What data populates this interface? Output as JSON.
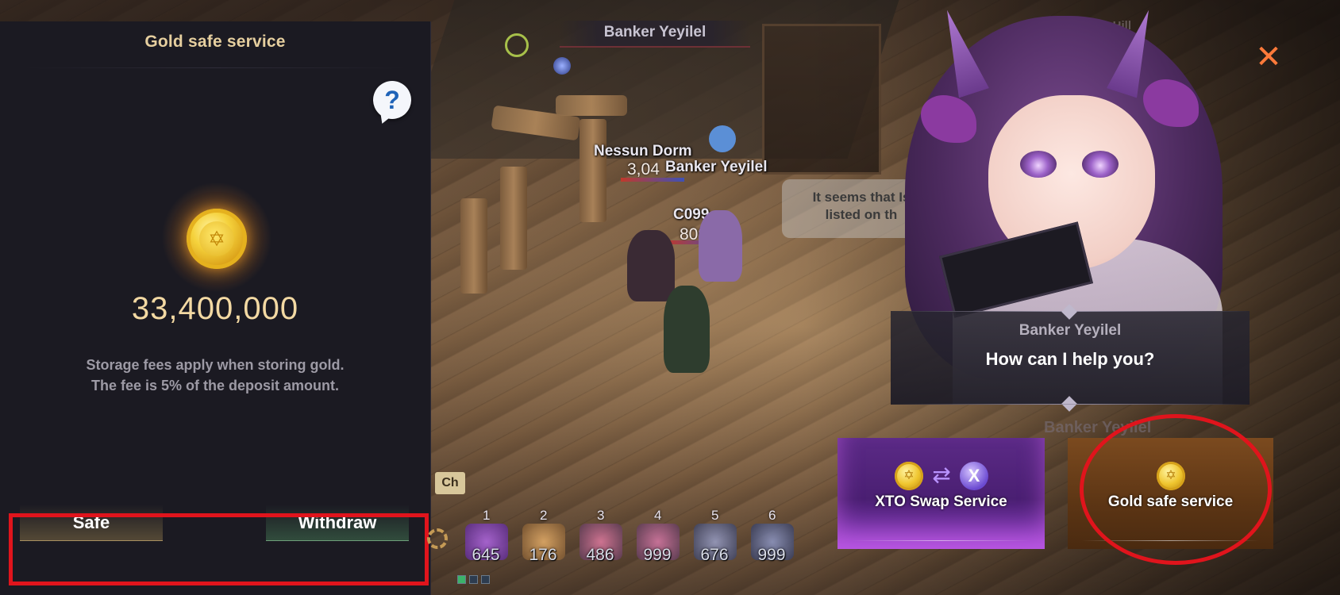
{
  "panel": {
    "title": "Gold safe service",
    "help_icon_glyph": "?",
    "gold_amount": "33,400,000",
    "fee_note_line1": "Storage fees apply when storing gold.",
    "fee_note_line2": "The fee is 5% of the deposit amount.",
    "safe_label": "Safe",
    "withdraw_label": "Withdraw"
  },
  "world": {
    "top_banner": "Banker Yeyilel",
    "players": [
      {
        "name": "Nessun Dorm",
        "value": "3,04"
      },
      {
        "name": "Banker Yeyilel"
      },
      {
        "name": "C099",
        "value": "809"
      }
    ],
    "speech_line1": "It seems that Is",
    "speech_line2": "listed on th",
    "faded_label": "Banker Yeyilel",
    "corner_text": "Rotten Hill"
  },
  "hotbar": {
    "channel_tag": "Ch",
    "slots": [
      {
        "key": "1",
        "count": "645",
        "icon": "purple-potion-icon"
      },
      {
        "key": "2",
        "count": "176",
        "icon": "food-plate-icon"
      },
      {
        "key": "3",
        "count": "486",
        "icon": "red-potion-icon"
      },
      {
        "key": "4",
        "count": "999",
        "icon": "red-potion-icon"
      },
      {
        "key": "5",
        "count": "676",
        "icon": "blue-potion-icon"
      },
      {
        "key": "6",
        "count": "999",
        "icon": "blue-potion-icon"
      }
    ]
  },
  "npc": {
    "name": "Banker Yeyilel",
    "dialog": "How can I help you?"
  },
  "services": {
    "xto_label": "XTO Swap Service",
    "gold_label": "Gold safe service",
    "x_glyph": "X",
    "swap_glyph": "⇄",
    "coin_glyph": "✡"
  },
  "close_glyph": "✕",
  "colors": {
    "panel_bg": "#1b1a22",
    "title_gold": "#e6cf9f",
    "highlight_red": "#e0141c",
    "close_orange": "#ff7a3a"
  }
}
